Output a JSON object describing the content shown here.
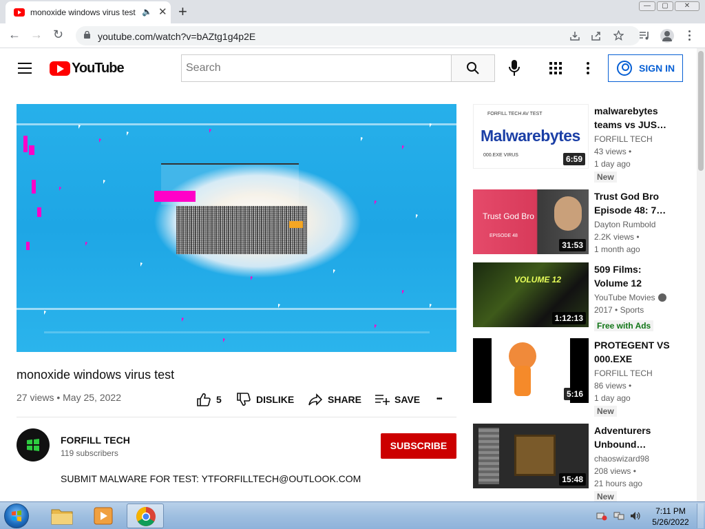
{
  "browser": {
    "tab_title": "monoxide windows virus test",
    "url": "youtube.com/watch?v=bAZtg1g4p2E",
    "min_glyph": "—",
    "max_glyph": "▢",
    "close_glyph": "✕",
    "new_tab_glyph": "+",
    "tab_close_glyph": "✕",
    "audio_glyph": "🔈",
    "back_glyph": "←",
    "forward_glyph": "→",
    "reload_glyph": "↻"
  },
  "youtube": {
    "logo_text": "YouTube",
    "search_placeholder": "Search",
    "sign_in_label": "SIGN IN"
  },
  "video": {
    "title": "monoxide windows virus test",
    "meta": "27 views • May 25, 2022",
    "like_count": "5",
    "dislike_label": "DISLIKE",
    "share_label": "SHARE",
    "save_label": "SAVE",
    "more_glyph": "•••"
  },
  "channel": {
    "name": "FORFILL TECH",
    "subscribers": "119 subscribers",
    "subscribe_label": "SUBSCRIBE",
    "description": "SUBMIT MALWARE FOR TEST: YTFORFILLTECH@OUTLOOK.COM"
  },
  "recommendations": [
    {
      "title": "malwarebytes teams vs JUS…",
      "channel": "FORFILL TECH",
      "views": "43 views •",
      "age": "1 day ago",
      "badge": "New",
      "duration": "6:59",
      "thumb_text": "FORFILL TECH AV TEST",
      "thumb_brand": "Malwarebytes",
      "thumb_sub": "000.EXE VIRUS"
    },
    {
      "title": "Trust God Bro Episode 48: 7…",
      "channel": "Dayton Rumbold",
      "views": "2.2K views •",
      "age": "1 month ago",
      "duration": "31:53",
      "thumb_text": "Trust God Bro",
      "thumb_sub": "EPISODE 48"
    },
    {
      "title": "509 Films: Volume 12",
      "channel": "YouTube Movies",
      "views": "2017 • Sports",
      "badge": "Free with Ads",
      "duration": "1:12:13",
      "thumb_text": "VOLUME 12"
    },
    {
      "title": "PROTEGENT VS 000.EXE",
      "channel": "FORFILL TECH",
      "views": "86 views •",
      "age": "1 day ago",
      "badge": "New",
      "duration": "5:16"
    },
    {
      "title": "Adventurers Unbound…",
      "channel": "chaoswizard98",
      "views": "208 views •",
      "age": "21 hours ago",
      "badge": "New",
      "duration": "15:48"
    }
  ],
  "taskbar": {
    "time": "7:11 PM",
    "date": "5/26/2022"
  },
  "colors": {
    "youtube_red": "#ff0000",
    "subscribe_red": "#cc0000",
    "link_blue": "#065fd4",
    "player_blue": "#1ea6e5"
  }
}
